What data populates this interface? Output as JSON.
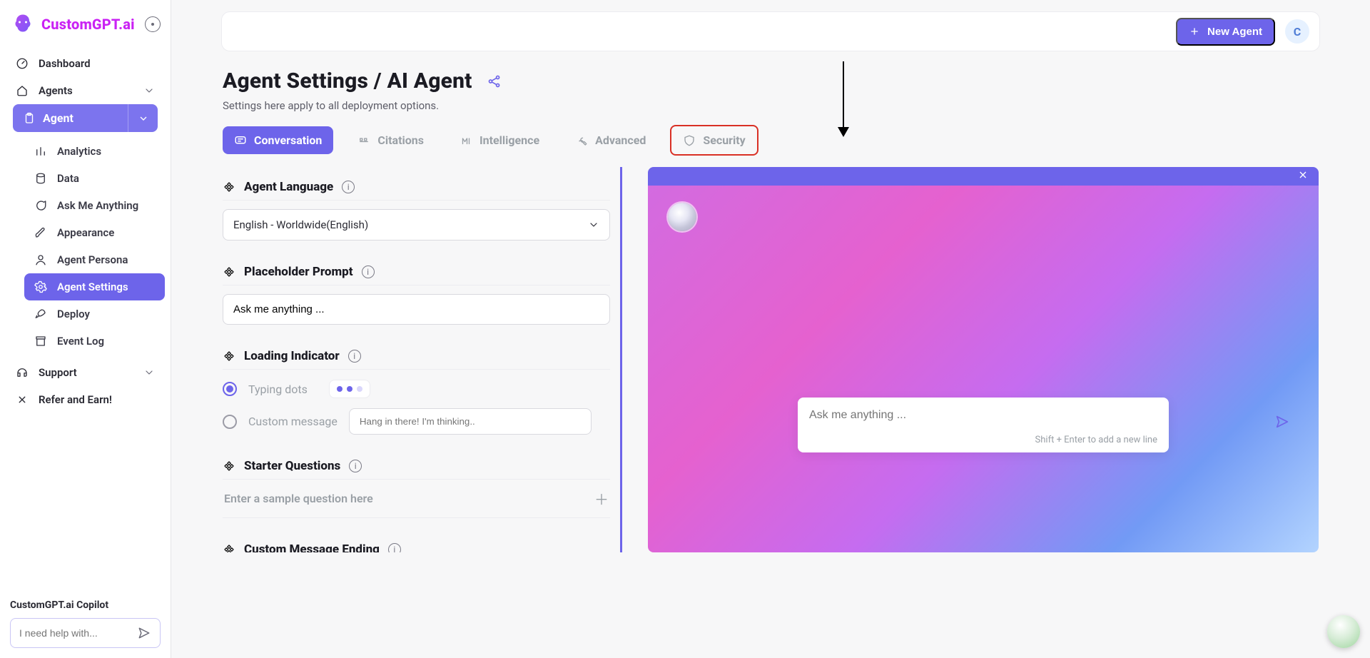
{
  "brand": {
    "name": "CustomGPT.ai"
  },
  "sidebar": {
    "dashboard": "Dashboard",
    "agents": "Agents",
    "agent": "Agent",
    "items": [
      {
        "label": "Analytics"
      },
      {
        "label": "Data"
      },
      {
        "label": "Ask Me Anything"
      },
      {
        "label": "Appearance"
      },
      {
        "label": "Agent Persona"
      },
      {
        "label": "Agent Settings"
      },
      {
        "label": "Deploy"
      },
      {
        "label": "Event Log"
      }
    ],
    "support": "Support",
    "refer": "Refer and Earn!",
    "copilot_title": "CustomGPT.ai Copilot",
    "copilot_placeholder": "I need help with..."
  },
  "header": {
    "new_agent": "New Agent",
    "avatar_initial": "C"
  },
  "page": {
    "title": "Agent Settings / AI Agent",
    "subtitle": "Settings here apply to all deployment options."
  },
  "tabs": {
    "conversation": "Conversation",
    "citations": "Citations",
    "intelligence": "Intelligence",
    "advanced": "Advanced",
    "security": "Security"
  },
  "settings": {
    "agent_language": {
      "title": "Agent Language",
      "value": "English - Worldwide(English)"
    },
    "placeholder_prompt": {
      "title": "Placeholder Prompt",
      "value": "Ask me anything ..."
    },
    "loading_indicator": {
      "title": "Loading Indicator",
      "typing_dots": "Typing dots",
      "custom_message": "Custom message",
      "custom_placeholder": "Hang in there! I'm thinking.."
    },
    "starter_questions": {
      "title": "Starter Questions",
      "sample_placeholder": "Enter a sample question here"
    },
    "custom_ending": {
      "title": "Custom Message Ending"
    }
  },
  "preview": {
    "ask_placeholder": "Ask me anything ...",
    "shift_hint": "Shift + Enter to add a new line"
  }
}
